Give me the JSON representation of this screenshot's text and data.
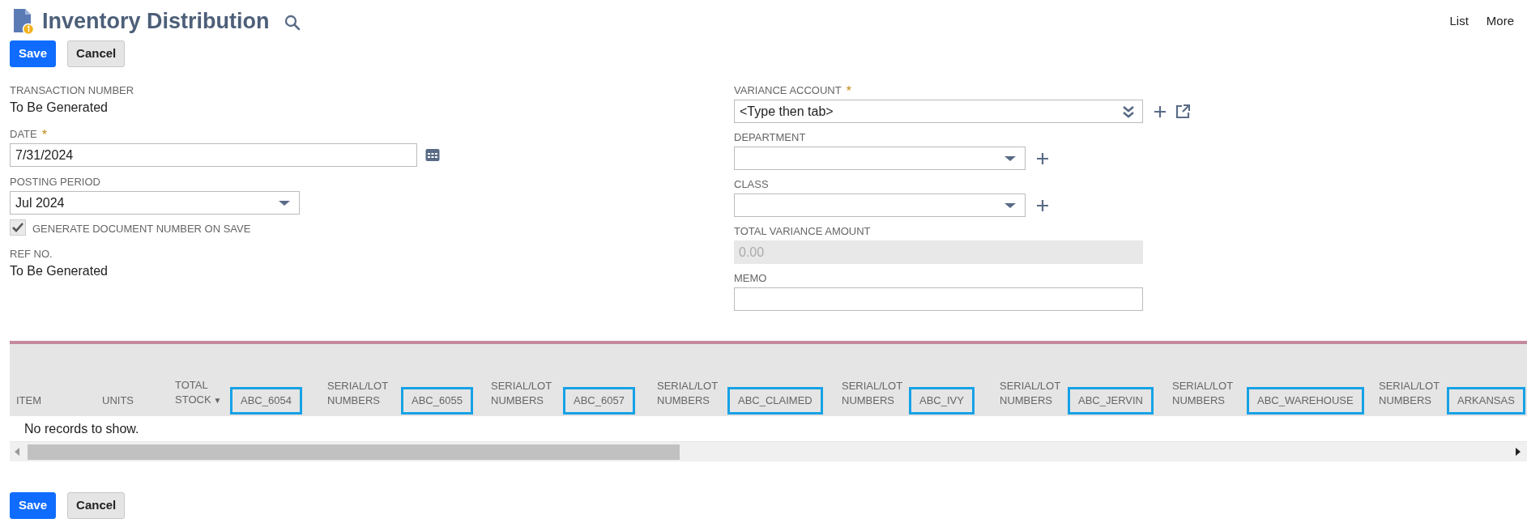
{
  "header": {
    "title": "Inventory Distribution",
    "links": [
      "List",
      "More"
    ]
  },
  "required_marker": "*",
  "top_buttons": [
    {
      "label": "Save",
      "kind": "primary"
    },
    {
      "label": "Cancel",
      "kind": "secondary"
    }
  ],
  "left_fields": [
    {
      "kind": "text",
      "label": "TRANSACTION NUMBER",
      "value": "To Be Generated"
    },
    {
      "kind": "date",
      "label": "DATE",
      "value": "7/31/2024",
      "required": true
    },
    {
      "kind": "select",
      "label": "POSTING PERIOD",
      "value": "Jul 2024"
    },
    {
      "kind": "checkbox",
      "label": "GENERATE DOCUMENT NUMBER ON SAVE",
      "checked": true,
      "disabled": true
    },
    {
      "kind": "text",
      "label": "REF NO.",
      "value": "To Be Generated"
    }
  ],
  "right_fields": [
    {
      "kind": "combo",
      "label": "VARIANCE ACCOUNT",
      "placeholder": "<Type then tab>",
      "required": true
    },
    {
      "kind": "select",
      "label": "DEPARTMENT"
    },
    {
      "kind": "select",
      "label": "CLASS"
    },
    {
      "kind": "readonly",
      "label": "TOTAL VARIANCE AMOUNT",
      "value": "0.00"
    },
    {
      "kind": "textarea",
      "label": "MEMO"
    }
  ],
  "table": {
    "columns": [
      {
        "label": "ITEM",
        "highlighted": false
      },
      {
        "label": "UNITS",
        "highlighted": false
      },
      {
        "label": "TOTAL STOCK",
        "sort_indicator": "▼",
        "highlighted": false
      },
      {
        "label": "ABC_6054",
        "highlighted": true
      },
      {
        "label": "SERIAL/LOT NUMBERS",
        "highlighted": false
      },
      {
        "label": "ABC_6055",
        "highlighted": true
      },
      {
        "label": "SERIAL/LOT NUMBERS",
        "highlighted": false
      },
      {
        "label": "ABC_6057",
        "highlighted": true
      },
      {
        "label": "SERIAL/LOT NUMBERS",
        "highlighted": false
      },
      {
        "label": "ABC_CLAIMED",
        "highlighted": true
      },
      {
        "label": "SERIAL/LOT NUMBERS",
        "highlighted": false
      },
      {
        "label": "ABC_IVY",
        "highlighted": true
      },
      {
        "label": "SERIAL/LOT NUMBERS",
        "highlighted": false
      },
      {
        "label": "ABC_JERVIN",
        "highlighted": true
      },
      {
        "label": "SERIAL/LOT NUMBERS",
        "highlighted": false
      },
      {
        "label": "ABC_WAREHOUSE",
        "highlighted": true
      },
      {
        "label": "SERIAL/LOT NUMBERS",
        "highlighted": false
      },
      {
        "label": "ARKANSAS",
        "highlighted": true
      }
    ],
    "empty_message": "No records to show."
  },
  "bottom_buttons": [
    {
      "label": "Save",
      "kind": "primary"
    },
    {
      "label": "Cancel",
      "kind": "secondary"
    }
  ]
}
